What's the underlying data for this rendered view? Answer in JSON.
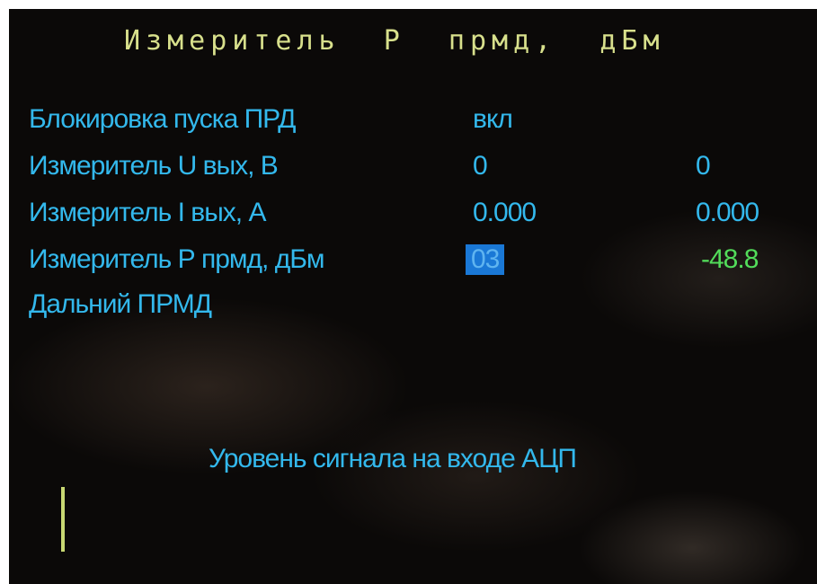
{
  "screen": {
    "title": "Измеритель  Р  прмд,  дБм"
  },
  "rows": [
    {
      "label": "Блокировка пуска ПРД",
      "value_a": "вкл",
      "value_b": ""
    },
    {
      "label": "Измеритель U вых, В",
      "value_a": "0",
      "value_b": "0"
    },
    {
      "label": "Измеритель I вых, А",
      "value_a": "0.000",
      "value_b": "0.000"
    },
    {
      "label": "Измеритель Р прмд, дБм",
      "value_a": "03",
      "value_b": "-48.8"
    },
    {
      "label": "Дальний ПРМД",
      "value_a": "",
      "value_b": ""
    }
  ],
  "caption": "Уровень сигнала на входе АЦП",
  "signal_level_indicator": {
    "fill_fraction": 0.08
  },
  "colors": {
    "title": "#d8e08c",
    "text": "#33b8ec",
    "selection_bg": "#1a78d6",
    "measured_value": "#52dc5a",
    "level_bar": "#c8d872",
    "background": "#0b0908"
  }
}
